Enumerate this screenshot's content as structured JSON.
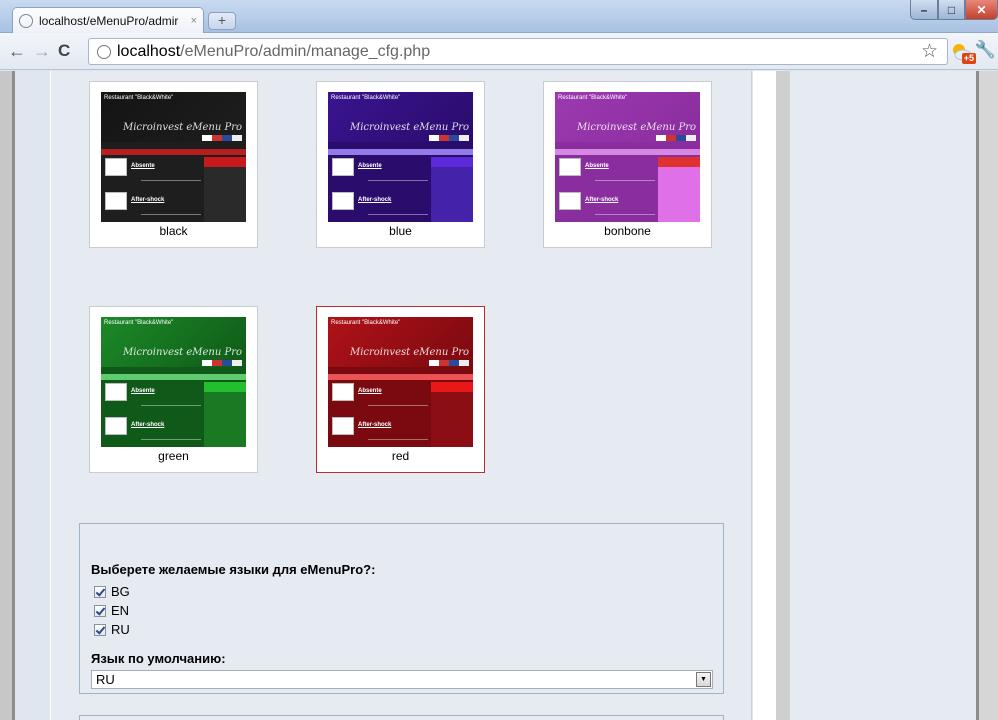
{
  "browser": {
    "tab_title": "localhost/eMenuPro/admir",
    "tab_close": "×",
    "new_tab": "+",
    "url_host": "localhost",
    "url_path": "/eMenuPro/admin/manage_cfg.php",
    "extension_badge": "+5"
  },
  "themes": [
    {
      "name": "black",
      "selected": false,
      "colors": {
        "head": "#141414",
        "rest": "#1e1e1e",
        "bar": "#d02020",
        "menu": "#2a2a2a",
        "menu_top": "#c81a1a"
      }
    },
    {
      "name": "blue",
      "selected": false,
      "colors": {
        "head": "#3a1490",
        "rest": "#2a0c6c",
        "bar": "#a690ff",
        "menu": "#4422aa",
        "menu_top": "#5a2ad8"
      }
    },
    {
      "name": "bonbone",
      "selected": false,
      "colors": {
        "head": "#9c39b0",
        "rest": "#8a2d9e",
        "bar": "#e29aef",
        "menu": "#e070e8",
        "menu_top": "#e03030"
      }
    },
    {
      "name": "green",
      "selected": false,
      "colors": {
        "head": "#1c8a28",
        "rest": "#0f5a18",
        "bar": "#6ee080",
        "menu": "#1a7a24",
        "menu_top": "#22c02f"
      }
    },
    {
      "name": "red",
      "selected": true,
      "colors": {
        "head": "#b01218",
        "rest": "#7a0a10",
        "bar": "#ff6060",
        "menu": "#8a0e14",
        "menu_top": "#e81818"
      }
    }
  ],
  "thumbnail": {
    "restaurant": "Restaurant \"Black&White\"",
    "brand": "Microinvest eMenu Pro",
    "item1": "Absente",
    "item2": "After-shock"
  },
  "languages": {
    "label": "Выберете желаемые языки для eMenuPro?:",
    "options": [
      {
        "code": "BG",
        "checked": true
      },
      {
        "code": "EN",
        "checked": true
      },
      {
        "code": "RU",
        "checked": true
      }
    ],
    "default_label": "Язык по умолчанию:",
    "default_value": "RU"
  }
}
